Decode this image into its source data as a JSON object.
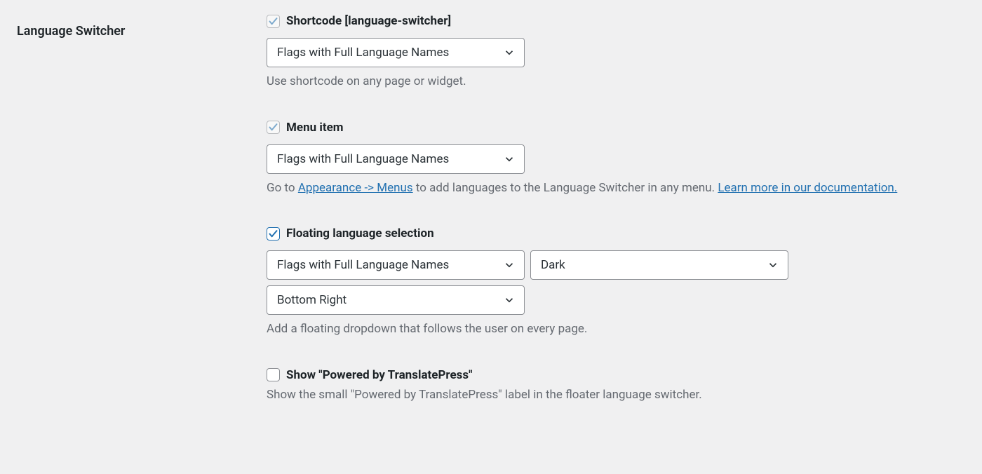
{
  "section_label": "Language Switcher",
  "shortcode": {
    "checked": true,
    "disabled": true,
    "label": "Shortcode [language-switcher]",
    "select_value": "Flags with Full Language Names",
    "description": "Use shortcode on any page or widget."
  },
  "menu_item": {
    "checked": true,
    "disabled": true,
    "label": "Menu item",
    "select_value": "Flags with Full Language Names",
    "desc_prefix": "Go to ",
    "link1_text": "Appearance -> Menus",
    "desc_middle": " to add languages to the Language Switcher in any menu. ",
    "link2_text": "Learn more in our documentation."
  },
  "floating": {
    "checked": true,
    "disabled": false,
    "label": "Floating language selection",
    "select_display": "Flags with Full Language Names",
    "select_theme": "Dark",
    "select_position": "Bottom Right",
    "description": "Add a floating dropdown that follows the user on every page."
  },
  "powered": {
    "checked": false,
    "disabled": false,
    "label": "Show \"Powered by TranslatePress\"",
    "description": "Show the small \"Powered by TranslatePress\" label in the floater language switcher."
  }
}
